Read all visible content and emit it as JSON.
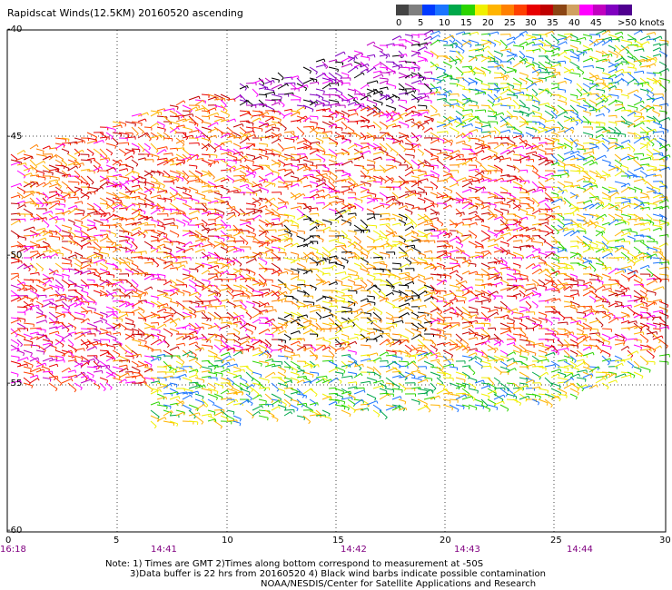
{
  "title": "Rapidscat Winds(12.5KM) 20160520 ascending",
  "legend": {
    "labels": [
      "0",
      "5",
      "10",
      "15",
      "20",
      "25",
      "30",
      "35",
      "40",
      "45",
      ">50 knots"
    ],
    "colors": [
      "#444444",
      "#7f7f7f",
      "#003aff",
      "#1b74ff",
      "#00a84a",
      "#2bd400",
      "#f0f000",
      "#ffb400",
      "#ff8000",
      "#ff4000",
      "#e80000",
      "#c00000",
      "#8b4513",
      "#d0a060",
      "#ff00ff",
      "#c000c0",
      "#8000c0",
      "#500090"
    ]
  },
  "map": {
    "lat_labels": [
      "-40",
      "-45",
      "-50",
      "-55",
      "-60"
    ],
    "lon_labels": [
      "0",
      "5",
      "10",
      "15",
      "20",
      "25",
      "30"
    ],
    "time_labels": [
      "16:18",
      "14:41",
      "14:42",
      "14:43",
      "14:44"
    ]
  },
  "notes": {
    "line1": "Note: 1) Times are GMT 2)Times along bottom correspond to measurement at -50S",
    "line2": "3)Data buffer is 22 hrs from 20160520 4) Black wind barbs indicate possible contamination",
    "line3": "NOAA/NESDIS/Center for Satellite Applications and Research"
  }
}
